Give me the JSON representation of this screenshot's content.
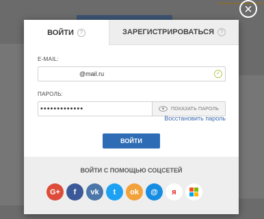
{
  "modal": {
    "tab_login": "ВОЙТИ",
    "tab_register": "ЗАРЕГИСТРИРОВАТЬСЯ",
    "help_glyph": "?",
    "email_label": "E-MAIL:",
    "email_value": "@mail.ru",
    "password_label": "ПАРОЛЬ:",
    "password_value": "•••••••••••••",
    "show_password": "ПОКАЗАТЬ ПАРОЛЬ",
    "restore_link": "Восстановить пароль",
    "submit_label": "ВОЙТИ",
    "social_title": "ВОЙТИ С ПОМОЩЬЮ СОЦСЕТЕЙ",
    "close_glyph": "×"
  },
  "social": [
    {
      "name": "google-plus-icon",
      "glyph": "G+",
      "color": "#dd4b39"
    },
    {
      "name": "facebook-icon",
      "glyph": "f",
      "color": "#3b5998"
    },
    {
      "name": "vk-icon",
      "glyph": "vk",
      "color": "#4a76a8"
    },
    {
      "name": "twitter-icon",
      "glyph": "t",
      "color": "#1da1f2"
    },
    {
      "name": "odnoklassniki-icon",
      "glyph": "ok",
      "color": "#f2a23b"
    },
    {
      "name": "mailru-icon",
      "glyph": "@",
      "color": "#168de2"
    },
    {
      "name": "yandex-icon",
      "glyph": "я",
      "color": "#ffffff"
    },
    {
      "name": "windows-icon",
      "glyph": "",
      "color": "#ffffff"
    }
  ]
}
